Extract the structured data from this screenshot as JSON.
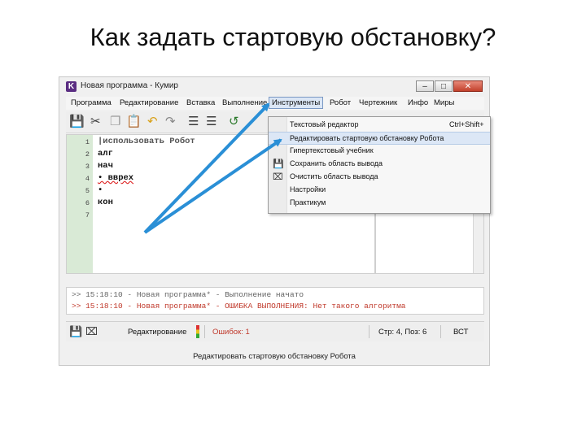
{
  "slide": {
    "title": "Как задать стартовую обстановку?"
  },
  "window": {
    "app_icon": "K",
    "title": "Новая программа - Кумир",
    "controls": {
      "minimize": "–",
      "maximize": "□",
      "close": "✕"
    }
  },
  "menubar": {
    "items": [
      {
        "label": "Программа"
      },
      {
        "label": "Редактирование"
      },
      {
        "label": "Вставка"
      },
      {
        "label": "Выполнение"
      },
      {
        "label": "Инструменты"
      },
      {
        "label": "Робот"
      },
      {
        "label": "Чертежник"
      },
      {
        "label": "Инфо"
      },
      {
        "label": "Миры"
      }
    ],
    "active_index": 4
  },
  "toolbar": {
    "icons": [
      "save-icon",
      "cut-icon",
      "copy-icon",
      "paste-icon",
      "undo-icon",
      "redo-icon",
      "indent-icon",
      "outdent-icon",
      "run-icon"
    ]
  },
  "editor": {
    "line_numbers": [
      "1",
      "2",
      "3",
      "4",
      "5",
      "6",
      "7"
    ],
    "lines": [
      "|использовать Робот",
      "алг",
      "нач",
      "• вврех",
      "•",
      "кон",
      ""
    ]
  },
  "dropdown": {
    "items": [
      {
        "label": "Текстовый редактор",
        "shortcut": "Ctrl+Shift+",
        "icon": ""
      },
      {
        "label": "Редактировать стартовую обстановку Робота",
        "shortcut": "",
        "icon": ""
      },
      {
        "label": "Гипертекстовый учебник",
        "shortcut": "",
        "icon": ""
      },
      {
        "label": "Сохранить область вывода",
        "shortcut": "",
        "icon": "save-icon"
      },
      {
        "label": "Очистить область вывода",
        "shortcut": "",
        "icon": "clear-icon"
      },
      {
        "label": "Настройки",
        "shortcut": "",
        "icon": ""
      },
      {
        "label": "Практикум",
        "shortcut": "",
        "icon": ""
      }
    ],
    "highlighted_index": 1
  },
  "log": {
    "lines": [
      ">> 15:18:10 - Новая программа* - Выполнение начато",
      ">> 15:18:10 - Новая программа* - ОШИБКА ВЫПОЛНЕНИЯ: Нет такого алгоритма"
    ],
    "colors": [
      "#666666",
      "#c0392b"
    ]
  },
  "statusbar": {
    "mode": "Редактирование",
    "errors": "Ошибок: 1",
    "position": "Стр: 4, Поз: 6",
    "insert_mode": "ВСТ"
  },
  "caption": "Редактировать стартовую обстановку Робота",
  "colors": {
    "arrow": "#2a8fd6",
    "error": "#c0392b",
    "gutter": "#d9ead6",
    "menu_highlight": "#dce7f6"
  }
}
